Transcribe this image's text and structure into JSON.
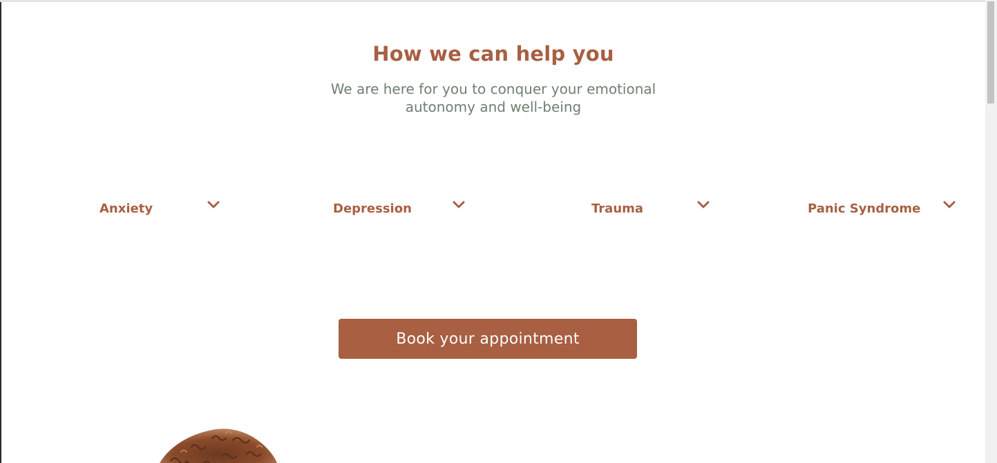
{
  "section": {
    "title": "How we can help you",
    "subtitle": "We are here for you to conquer your emotional autonomy and well-being"
  },
  "topics": [
    {
      "label": "Anxiety",
      "icon": "chevron-down-icon"
    },
    {
      "label": "Depression",
      "icon": "chevron-down-icon"
    },
    {
      "label": "Trauma",
      "icon": "chevron-down-icon"
    },
    {
      "label": "Panic Syndrome",
      "icon": "chevron-down-icon"
    }
  ],
  "cta": {
    "label": "Book your appointment"
  },
  "colors": {
    "accent": "#a85f42",
    "subtitle": "#6f7f72",
    "button_text": "#ffffff",
    "background": "#ffffff"
  }
}
